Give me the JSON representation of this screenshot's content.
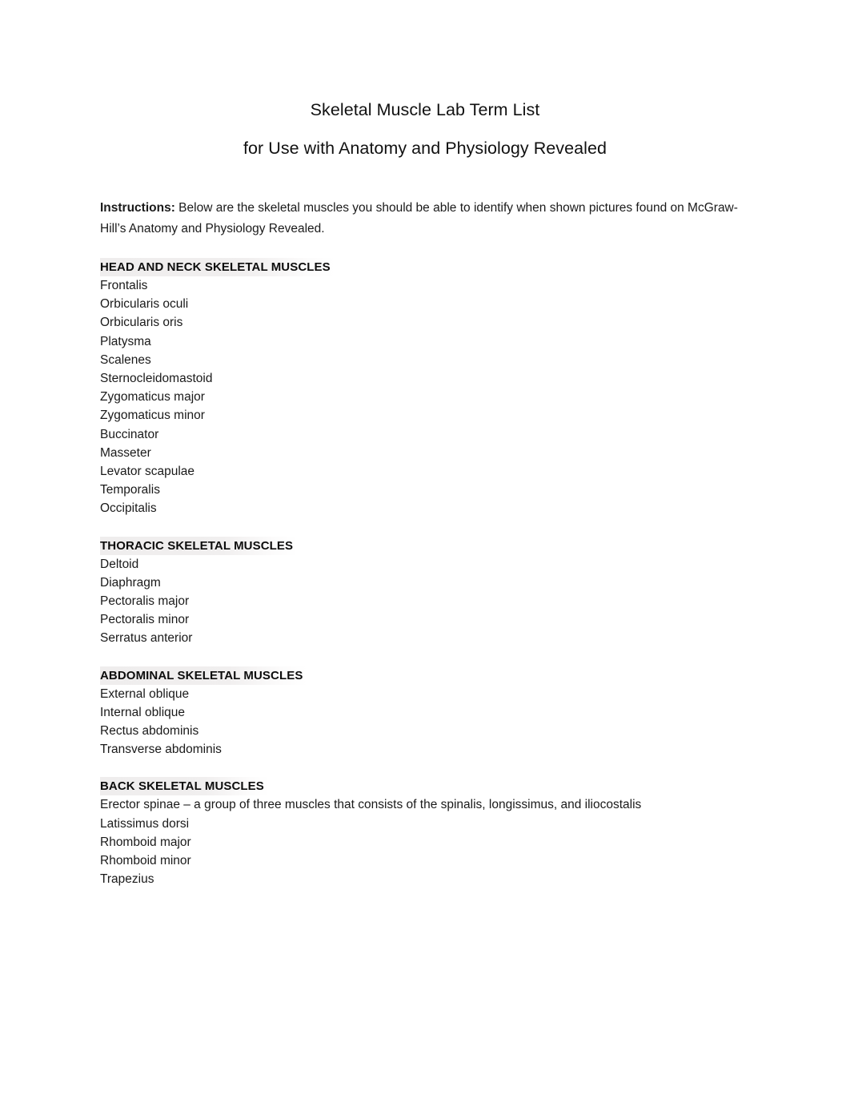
{
  "document": {
    "title_lines": [
      "Skeletal Muscle Lab Term List",
      "for Use with Anatomy and Physiology Revealed"
    ],
    "instructions": {
      "label": "Instructions:",
      "text": " Below are the skeletal muscles you should be able to identify when shown pictures found on McGraw-Hill’s Anatomy and Physiology Revealed."
    },
    "sections": [
      {
        "heading": "HEAD AND NECK SKELETAL MUSCLES",
        "terms": [
          "Frontalis",
          "Orbicularis oculi",
          "Orbicularis oris",
          "Platysma",
          "Scalenes",
          "Sternocleidomastoid",
          "Zygomaticus major",
          "Zygomaticus minor",
          "Buccinator",
          "Masseter",
          "Levator scapulae",
          "Temporalis",
          "Occipitalis"
        ]
      },
      {
        "heading": "THORACIC SKELETAL MUSCLES",
        "terms": [
          "Deltoid",
          "Diaphragm",
          "Pectoralis major",
          "Pectoralis minor",
          "Serratus anterior"
        ]
      },
      {
        "heading": "ABDOMINAL SKELETAL MUSCLES",
        "terms": [
          "External oblique",
          "Internal oblique",
          "Rectus abdominis",
          "Transverse abdominis"
        ]
      },
      {
        "heading": "BACK SKELETAL MUSCLES",
        "terms": [
          "Erector spinae – a group of three muscles that consists of the spinalis, longissimus, and iliocostalis",
          "Latissimus dorsi",
          "Rhomboid major",
          "Rhomboid minor",
          "Trapezius"
        ]
      }
    ]
  },
  "colors": {
    "page_background": "#ffffff",
    "body_text": "#1a1a1a",
    "heading_text": "#0d0d0d",
    "heading_highlight": "#efeded"
  }
}
